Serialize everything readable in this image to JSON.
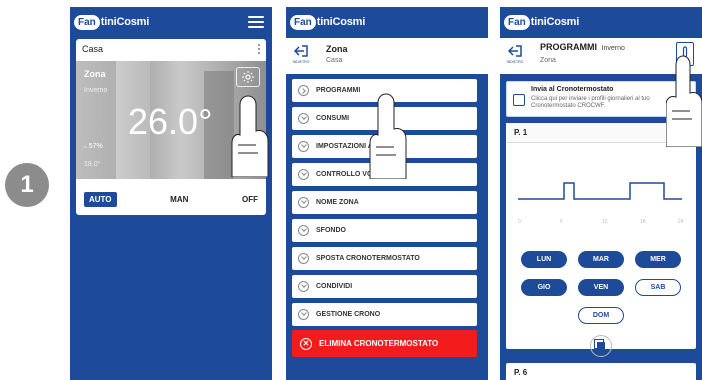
{
  "step_number": "1",
  "brand": {
    "mark": "Fan",
    "rest": "tiniCosmi"
  },
  "phone1": {
    "home_name": "Casa",
    "zone_name": "Zona",
    "season": "Inverno",
    "temperature": "26.0°",
    "humidity": "57%",
    "setpoint": "18.0°",
    "modes": [
      "AUTO",
      "MAN",
      "OFF"
    ],
    "active_mode": "AUTO"
  },
  "phone2": {
    "back_caption": "INDIETRO",
    "title": "Zona",
    "subtitle": "Casa",
    "menu": [
      "PROGRAMMI",
      "CONSUMI",
      "IMPOSTAZIONI AVANZATE",
      "CONTROLLO VOCALE",
      "NOME ZONA",
      "SFONDO",
      "SPOSTA CRONOTERMOSTATO",
      "CONDIVIDI",
      "GESTIONE CRONO"
    ],
    "delete_label": "ELIMINA CRONOTERMOSTATO"
  },
  "phone3": {
    "back_caption": "INDIETRO",
    "title": "PROGRAMMI",
    "mode": "Inverno",
    "subtitle": "Zona",
    "banner_title": "Invia al Cronotermostato",
    "banner_body": "Clicca qui per inviare i profili giornalieri al tuo Cronotermostato CROCWF.",
    "program_label": "P. 1",
    "axis_ticks": [
      "0",
      "6",
      "12",
      "18",
      "24"
    ],
    "days_row1": [
      "LUN",
      "MAR",
      "MER"
    ],
    "days_row2": [
      "GIO",
      "VEN",
      "SAB"
    ],
    "days_row3": [
      "DOM"
    ],
    "next_program_label": "P. 6"
  },
  "colors": {
    "brand_blue": "#1e4b99",
    "delete_red": "#f31c1c"
  }
}
